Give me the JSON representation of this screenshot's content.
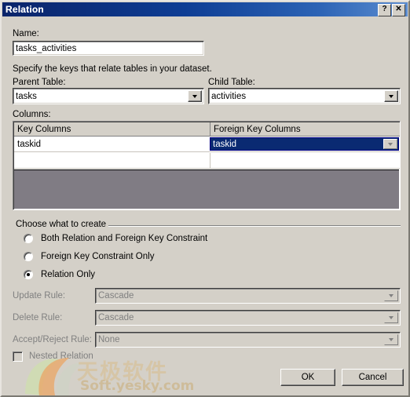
{
  "window": {
    "title": "Relation",
    "help_button": "?",
    "close_button": "✕"
  },
  "form": {
    "name_label": "Name:",
    "name_value": "tasks_activities",
    "instruction": "Specify the keys that relate tables in your dataset.",
    "parent_table_label": "Parent Table:",
    "parent_table_value": "tasks",
    "child_table_label": "Child Table:",
    "child_table_value": "activities",
    "columns_label": "Columns:"
  },
  "grid": {
    "headers": [
      "Key Columns",
      "Foreign Key Columns"
    ],
    "rows": [
      {
        "key_column": "taskid",
        "foreign_key_column": "taskid"
      },
      {
        "key_column": "",
        "foreign_key_column": ""
      }
    ],
    "selected_cell": "foreign_key_column"
  },
  "choose": {
    "group_label": "Choose what to create",
    "options": [
      {
        "label": "Both Relation and Foreign Key Constraint",
        "selected": false
      },
      {
        "label": "Foreign Key Constraint Only",
        "selected": false
      },
      {
        "label": "Relation Only",
        "selected": true
      }
    ]
  },
  "rules": [
    {
      "label": "Update Rule:",
      "value": "Cascade",
      "disabled": true
    },
    {
      "label": "Delete Rule:",
      "value": "Cascade",
      "disabled": true
    },
    {
      "label": "Accept/Reject Rule:",
      "value": "None",
      "disabled": true
    }
  ],
  "nested": {
    "label": "Nested Relation",
    "checked": false,
    "disabled": true
  },
  "footer": {
    "ok_label": "OK",
    "cancel_label": "Cancel"
  },
  "watermark": {
    "chinese": "天极软件",
    "english": "Soft.yesky.com"
  }
}
